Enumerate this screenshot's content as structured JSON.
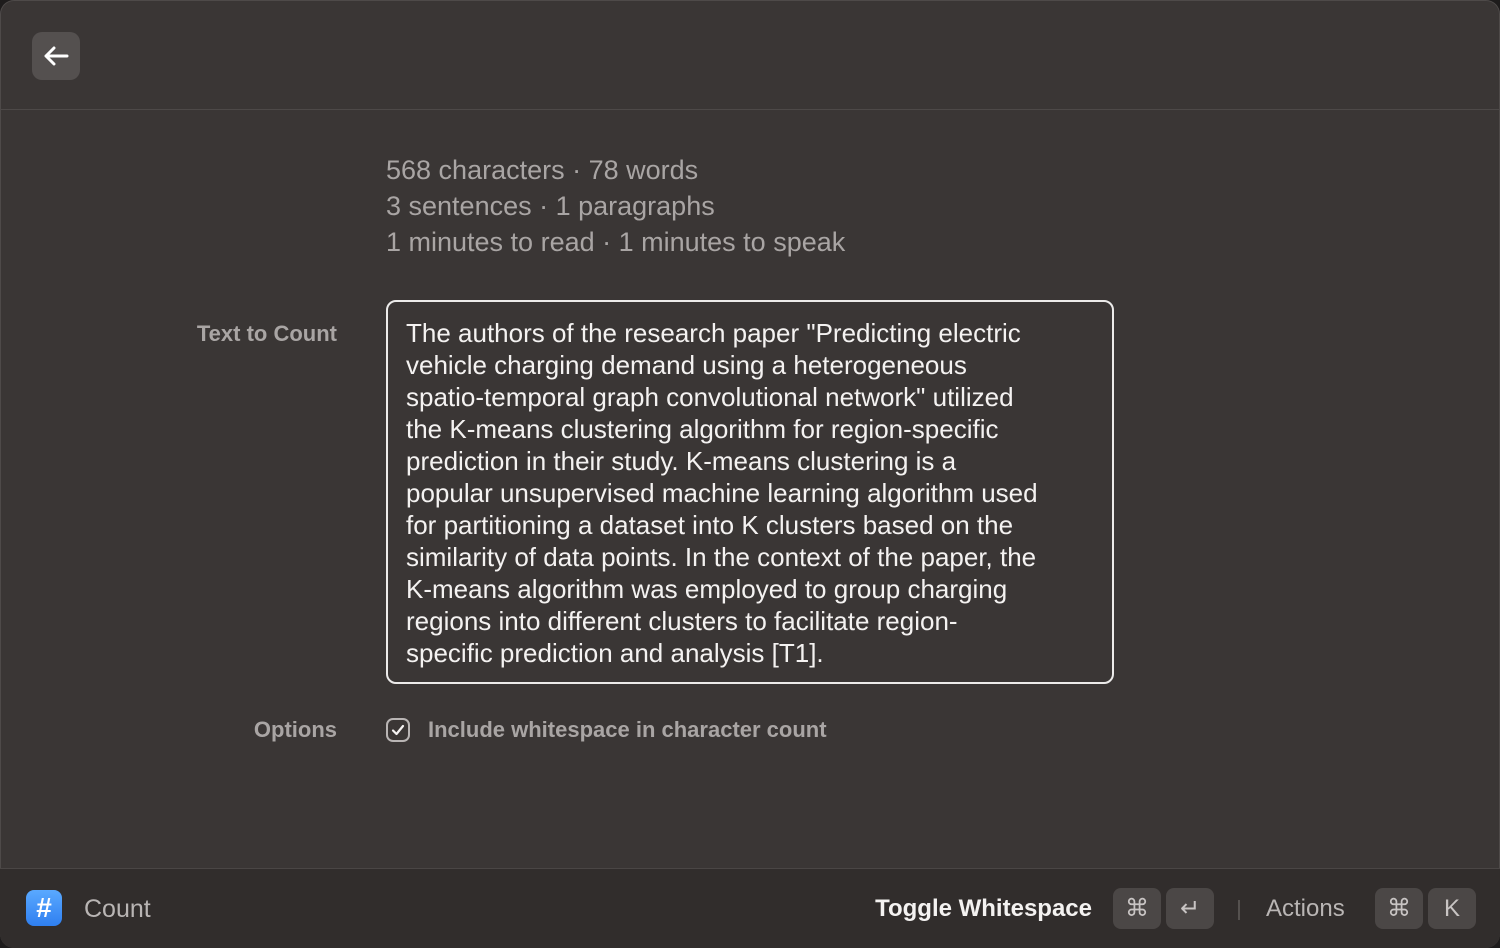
{
  "header": {
    "back_icon": "arrow-left-icon"
  },
  "stats": {
    "line1": "568 characters · 78 words",
    "line2": "3 sentences · 1 paragraphs",
    "line3": "1 minutes to read · 1 minutes to speak"
  },
  "form": {
    "text_label": "Text to Count",
    "text_value": "The authors of the research paper \"Predicting electric\nvehicle charging demand using a heterogeneous\nspatio-temporal graph convolutional network\" utilized\nthe K-means clustering algorithm for region-specific\nprediction in their study. K-means clustering is a\npopular unsupervised machine learning algorithm used\nfor partitioning a dataset into K clusters based on the\nsimilarity of data points. In the context of the paper, the\nK-means algorithm was employed to group charging\nregions into different clusters to facilitate region-\nspecific prediction and analysis [T1].",
    "options_label": "Options",
    "whitespace_option": {
      "label": "Include whitespace in character count",
      "checked": true
    }
  },
  "footer": {
    "app_icon": "hash-icon",
    "app_icon_glyph": "#",
    "app_name": "Count",
    "primary_action": "Toggle Whitespace",
    "primary_shortcut": [
      "⌘",
      "↵"
    ],
    "actions_label": "Actions",
    "actions_shortcut": [
      "⌘",
      "K"
    ]
  },
  "colors": {
    "background": "#3a3635",
    "footer": "#312d2c",
    "accent": "#3b8cf6",
    "text_primary": "#f4f2f1",
    "text_secondary": "#a9a5a4"
  }
}
